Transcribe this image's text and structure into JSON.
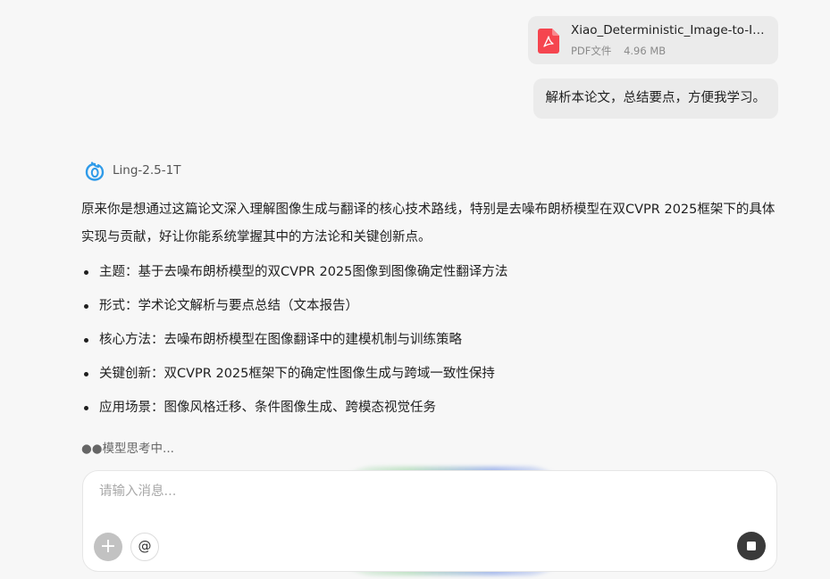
{
  "attachment": {
    "file_name": "Xiao_Deterministic_Image-to-Im...",
    "file_type": "PDF文件",
    "file_size": "4.96 MB",
    "icon": "pdf-icon",
    "icon_color": "#f5454f"
  },
  "user_message": "解析本论文，总结要点，方便我学习。",
  "assistant": {
    "model_name": "Ling-2.5-1T",
    "intro": "原来你是想通过这篇论文深入理解图像生成与翻译的核心技术路线，特别是去噪布朗桥模型在双CVPR 2025框架下的具体实现与贡献，好让你能系统掌握其中的方法论和关键创新点。",
    "bullets": [
      "主题：基于去噪布朗桥模型的双CVPR 2025图像到图像确定性翻译方法",
      "形式：学术论文解析与要点总结（文本报告）",
      "核心方法：去噪布朗桥模型在图像翻译中的建模机制与训练策略",
      "关键创新：双CVPR 2025框架下的确定性图像生成与跨域一致性保持",
      "应用场景：图像风格迁移、条件图像生成、跨模态视觉任务"
    ],
    "status": "●●模型思考中..."
  },
  "composer": {
    "placeholder": "请输入消息...",
    "value": "",
    "add_label": "+",
    "mention_label": "@"
  }
}
